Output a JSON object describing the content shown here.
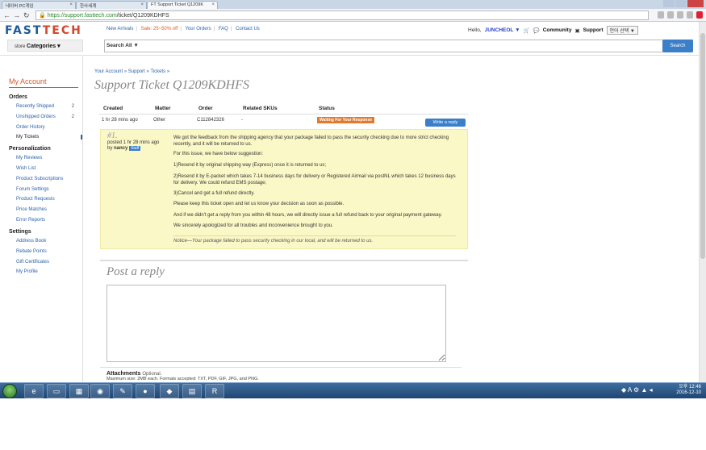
{
  "browser": {
    "tabs": [
      {
        "title": "네이버 PC게임"
      },
      {
        "title": "한사세계"
      },
      {
        "title": "FT Support Ticket Q1209K"
      }
    ],
    "url_prefix": "https://",
    "url_host": "support.fasttech.com",
    "url_path": "/ticket/Q1209KDHFS"
  },
  "header": {
    "logo_a": "FAST",
    "logo_b": "TECH",
    "nav": {
      "new_arrivals": "New Arrivals",
      "sale": "Sale: 25~50% off",
      "your_orders": "Your Orders",
      "faq": "FAQ",
      "contact": "Contact Us"
    },
    "hello": "Hello,",
    "username": "JUNCHEOL ▼",
    "community": "Community",
    "support": "Support",
    "language": "언어 선택 ▼",
    "store_label": "store",
    "categories": "Categories ▾",
    "search_scope": "Search All ▼",
    "search_button": "Search"
  },
  "sidebar": {
    "title": "My Account",
    "orders_heading": "Orders",
    "recently_shipped": "Recently Shipped",
    "recently_shipped_count": "2",
    "unshipped_orders": "Unshipped Orders",
    "unshipped_count": "2",
    "order_history": "Order History",
    "my_tickets": "My Tickets",
    "personalization_heading": "Personalization",
    "my_reviews": "My Reviews",
    "wish_list": "Wish List",
    "product_subscriptions": "Product Subscriptions",
    "forum_settings": "Forum Settings",
    "product_requests": "Product Requests",
    "price_matches": "Price Matches",
    "error_reports": "Error Reports",
    "settings_heading": "Settings",
    "address_book": "Address Book",
    "rebate_points": "Rebate Points",
    "gift_certificates": "Gift Certificates",
    "my_profile": "My Profile"
  },
  "main": {
    "breadcrumb": "Your Account » Support » Tickets »",
    "title": "Support Ticket Q1209KDHFS",
    "columns": {
      "created": "Created",
      "matter": "Matter",
      "order": "Order",
      "skus": "Related SKUs",
      "status": "Status"
    },
    "row": {
      "created": "1 hr 28 mins ago",
      "matter": "Other",
      "order": "C112842326",
      "skus": "-",
      "status": "Waiting For Your Response"
    },
    "write_reply": "Write a reply",
    "message": {
      "number": "#1.",
      "posted": "posted 1 hr 28 mins ago",
      "by": "by",
      "author": "nancy",
      "staff_badge": "Staff",
      "p1": "We got the feedback from the shipping agency that your package failed to pass the security checking due to more strict checking recently, and it will be returned to us.",
      "p2": "For this issue, we have below suggestion:",
      "p3": "1)Resend it by original shipping way (Express) once it is returned to us;",
      "p4": "2)Resend it by E-packet which takes 7-14 business days for delivery or Registered Airmail via postNL which takes 12 business days for delivery. We could refund EMS postage;",
      "p5": "3)Cancel and get a full refund directly.",
      "p6": "Please keep this ticket open and let us know your decision as soon as possible.",
      "p7": "And if we didn't get a reply from you within 48 hours, we will directly issue a full refund back to your original payment gateway.",
      "p8": "We sincerely apologized for all troubles and inconvenience brought to you.",
      "notice": "Notice—Your package failed to pass security checking in our local, and will be returned to us."
    },
    "post_reply_title": "Post a reply",
    "attachments_title": "Attachments",
    "attachments_optional": "Optional.",
    "attachments_note": "Maximum size: 2MB each. Formats accepted: TXT, PDF, GIF, JPG, and PNG."
  },
  "taskbar": {
    "time": "오후 12:46",
    "date": "2016-12-10"
  }
}
